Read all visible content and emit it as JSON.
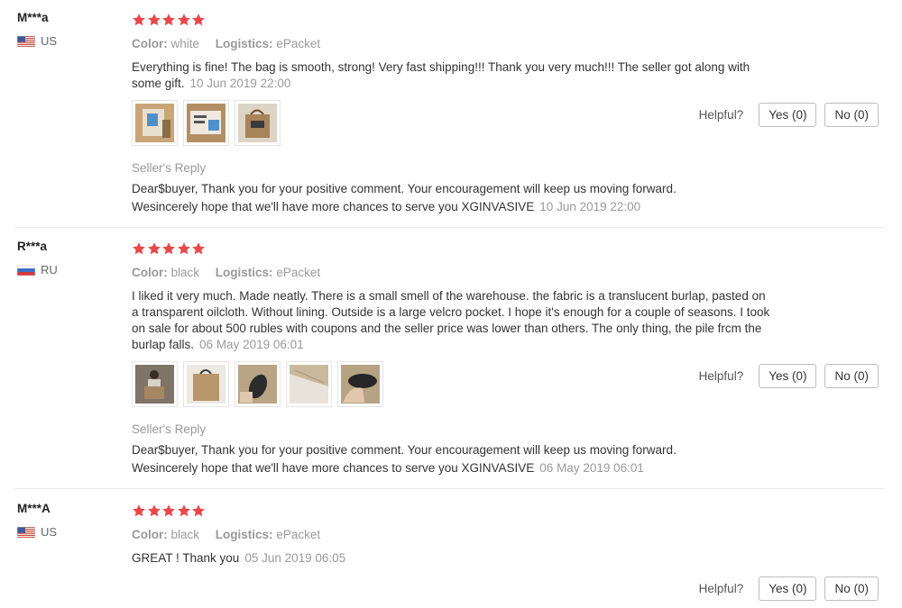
{
  "colors": {
    "star": "#e8484c",
    "meta": "#999999",
    "divider": "#e8e8e8"
  },
  "helpful_label": "Helpful?",
  "reviews": [
    {
      "user": "M***a",
      "country": "US",
      "flag": "us-flag-icon",
      "rating": 5,
      "attr_color_label": "Color:",
      "attr_color_value": "white",
      "attr_logistics_label": "Logistics:",
      "attr_logistics_value": "ePacket",
      "text": "Everything is fine! The bag is smooth, strong! Very fast shipping!!! Thank you very much!!! The seller got along with some gift.",
      "date": "10 Jun 2019 22:00",
      "photo_count": 3,
      "reply_title": "Seller's Reply",
      "reply_line1": "Dear$buyer, Thank you for your positive comment. Your encouragement will keep us moving forward.",
      "reply_line2": "Wesincerely hope that we'll have more chances to serve you XGINVASIVE",
      "reply_date": "10 Jun 2019 22:00",
      "yes": "Yes (0)",
      "no": "No (0)"
    },
    {
      "user": "R***a",
      "country": "RU",
      "flag": "ru-flag-icon",
      "rating": 5,
      "attr_color_label": "Color:",
      "attr_color_value": "black",
      "attr_logistics_label": "Logistics:",
      "attr_logistics_value": "ePacket",
      "text": "I liked it very much. Made neatly. There is a small smell of the warehouse. the fabric is a translucent burlap, pasted on a transparent oilcloth. Without lining. Outside is a large velcro pocket. I hope it's enough for a couple of seasons. I took on sale for about 500 rubles with coupons and the seller price was lower than others. The only thing, the pile frcm the burlap falls.",
      "date": "06 May 2019 06:01",
      "photo_count": 5,
      "reply_title": "Seller's Reply",
      "reply_line1": "Dear$buyer, Thank you for your positive comment. Your encouragement will keep us moving forward.",
      "reply_line2": "Wesincerely hope that we'll have more chances to serve you XGINVASIVE",
      "reply_date": "06 May 2019 06:01",
      "yes": "Yes (0)",
      "no": "No (0)"
    },
    {
      "user": "M***A",
      "country": "US",
      "flag": "us-flag-icon",
      "rating": 5,
      "attr_color_label": "Color:",
      "attr_color_value": "black",
      "attr_logistics_label": "Logistics:",
      "attr_logistics_value": "ePacket",
      "text": "GREAT ! Thank you",
      "date": "05 Jun 2019 06:05",
      "yes": "Yes (0)",
      "no": "No (0)"
    }
  ]
}
